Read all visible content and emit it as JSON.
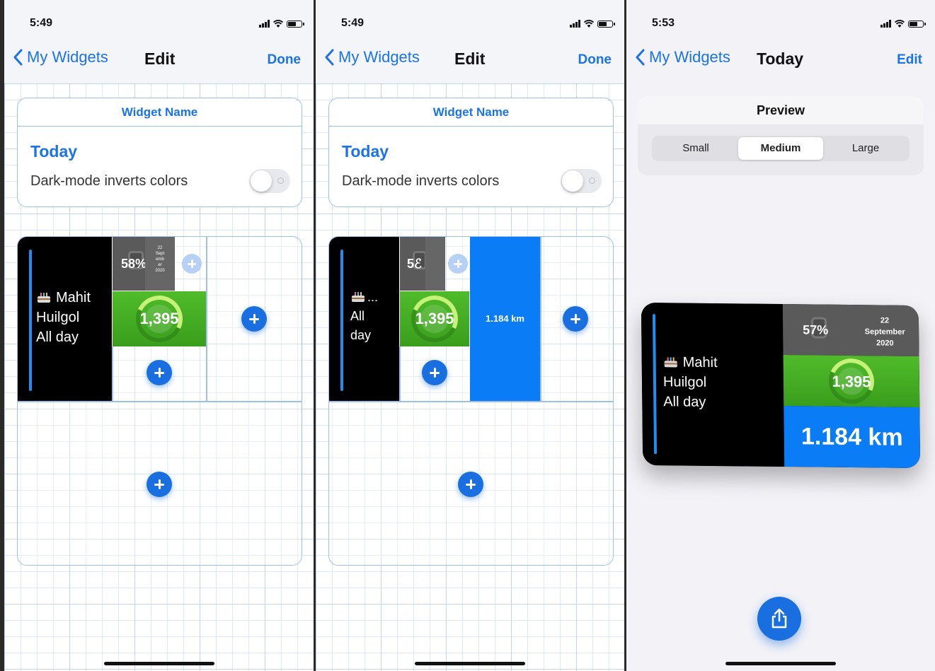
{
  "screens": [
    {
      "status": {
        "time": "5:49"
      },
      "nav": {
        "back_label": "My Widgets",
        "title": "Edit",
        "action": "Done"
      },
      "card": {
        "header": "Widget Name",
        "name": "Today",
        "dark_label": "Dark-mode inverts colors"
      },
      "widget": {
        "event_line1": "Mahit",
        "event_line2": "Huilgol",
        "event_line3": "All day",
        "battery_text": "58%",
        "date_text": "22\nSept\nemb\ner\n2020",
        "steps": "1,395"
      }
    },
    {
      "status": {
        "time": "5:49"
      },
      "nav": {
        "back_label": "My Widgets",
        "title": "Edit",
        "action": "Done"
      },
      "card": {
        "header": "Widget Name",
        "name": "Today",
        "dark_label": "Dark-mode inverts colors"
      },
      "widget": {
        "event_line1": "...",
        "event_line2": "All",
        "event_line3": "day",
        "battery_text": "5ℰ",
        "steps": "1,395",
        "distance": "1.184 km"
      }
    },
    {
      "status": {
        "time": "5:53"
      },
      "nav": {
        "back_label": "My Widgets",
        "title": "Today",
        "action": "Edit"
      },
      "preview": {
        "title": "Preview",
        "sizes": [
          "Small",
          "Medium",
          "Large"
        ],
        "selected": "Medium"
      },
      "widget": {
        "event_line1": "Mahit",
        "event_line2": "Huilgol",
        "event_line3": "All day",
        "battery_text": "57%",
        "date_day": "22",
        "date_month": "September",
        "date_year": "2020",
        "steps": "1,395",
        "distance": "1.184 km"
      }
    }
  ],
  "colors": {
    "accent": "#1a73e8",
    "green": "#46b024",
    "blue_tile": "#0a7cf5",
    "gray_tile": "#5a5a5a"
  },
  "icons": [
    "chevron-left-icon",
    "signal-icon",
    "wifi-icon",
    "battery-icon",
    "plus-icon",
    "cake-icon",
    "share-icon"
  ]
}
